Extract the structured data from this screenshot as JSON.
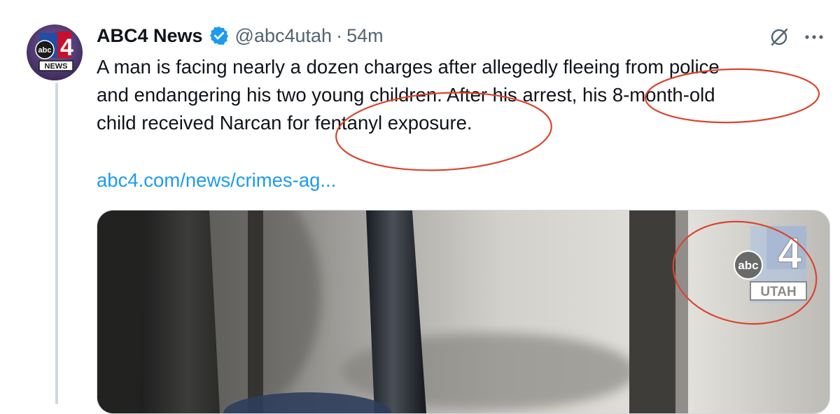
{
  "tweet": {
    "author_name": "ABC4 News",
    "handle": "@abc4utah",
    "separator": "·",
    "time": "54m",
    "text_lines": [
      "A man is facing nearly a dozen charges after allegedly fleeing from police",
      "and endangering his two young children. After his arrest, his 8-month-old",
      "child received Narcan for fentanyl exposure."
    ],
    "link_text": "abc4.com/news/crimes-ag..."
  },
  "avatar": {
    "logo_text": "abc",
    "logo_number": "4",
    "logo_banner": "NEWS"
  },
  "media": {
    "watermark_abc": "abc",
    "watermark_number": "4",
    "watermark_banner": "UTAH"
  },
  "icons": {
    "verified": "verified-badge-icon",
    "grok": "grok-icon",
    "more": "more-icon"
  },
  "colors": {
    "link": "#1d9bf0",
    "verified": "#1d9bf0",
    "annotation": "#d9452f",
    "secondary_text": "#536471"
  }
}
